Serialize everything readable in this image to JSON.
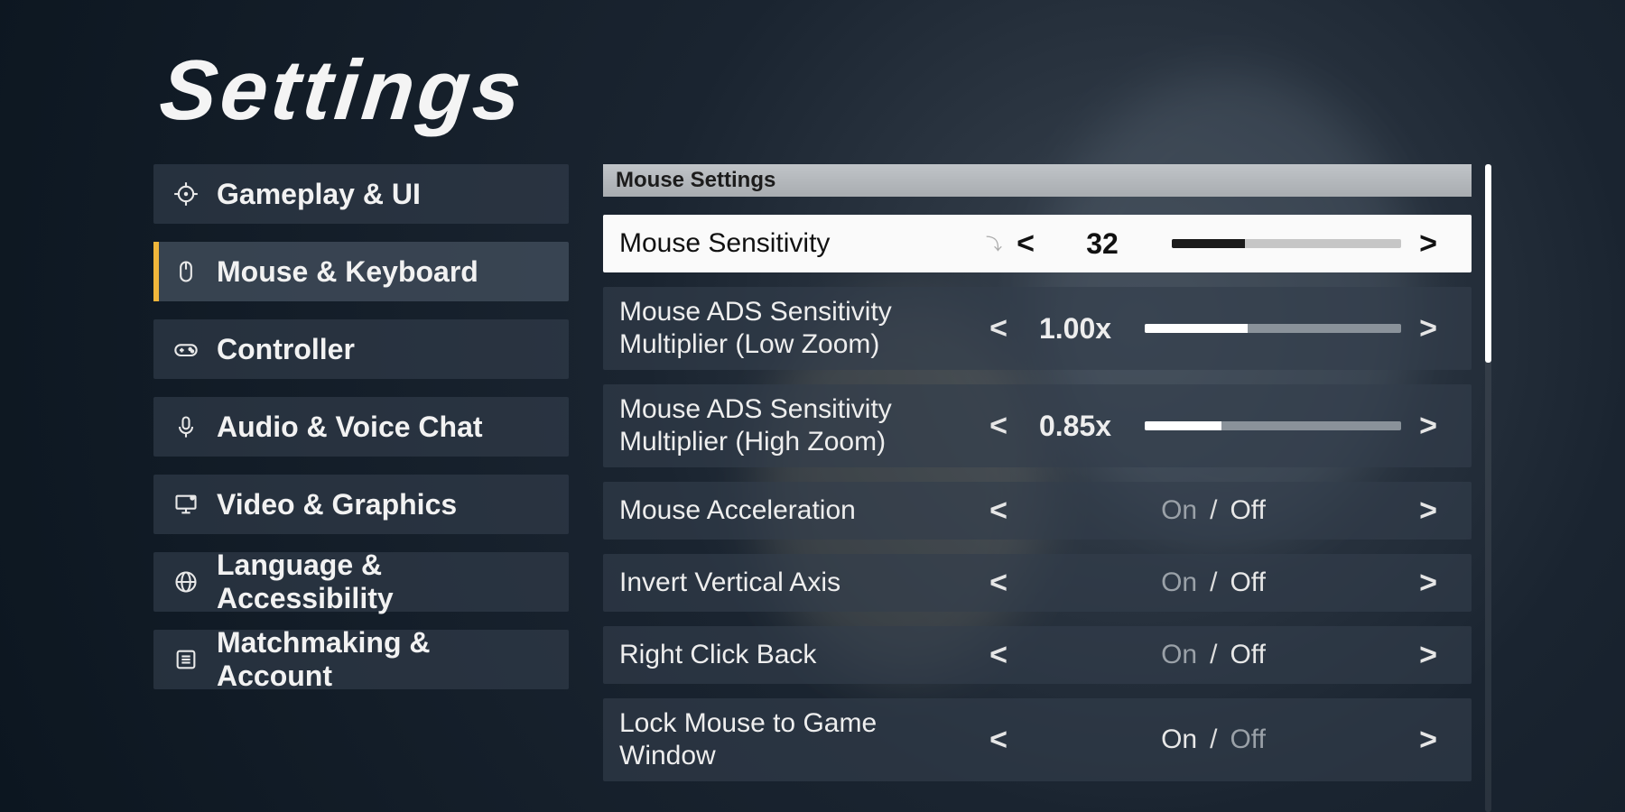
{
  "title": "Settings",
  "nav": {
    "items": [
      {
        "label": "Gameplay & UI",
        "icon": "crosshair-icon",
        "selected": false
      },
      {
        "label": "Mouse & Keyboard",
        "icon": "mouse-icon",
        "selected": true
      },
      {
        "label": "Controller",
        "icon": "gamepad-icon",
        "selected": false
      },
      {
        "label": "Audio & Voice Chat",
        "icon": "mic-icon",
        "selected": false
      },
      {
        "label": "Video & Graphics",
        "icon": "monitor-icon",
        "selected": false
      },
      {
        "label": "Language & Accessibility",
        "icon": "globe-icon",
        "selected": false
      },
      {
        "label": "Matchmaking & Account",
        "icon": "list-icon",
        "selected": false
      }
    ]
  },
  "panel": {
    "section_header": "Mouse Settings",
    "rows": [
      {
        "label": "Mouse Sensitivity",
        "kind": "slider",
        "value_text": "32",
        "fill_pct": 32,
        "highlight": true
      },
      {
        "label": "Mouse ADS Sensitivity Multiplier (Low Zoom)",
        "kind": "slider",
        "value_text": "1.00x",
        "fill_pct": 40,
        "highlight": false
      },
      {
        "label": "Mouse ADS Sensitivity Multiplier (High Zoom)",
        "kind": "slider",
        "value_text": "0.85x",
        "fill_pct": 30,
        "highlight": false
      },
      {
        "label": "Mouse Acceleration",
        "kind": "toggle",
        "on": "On",
        "off": "Off",
        "selected": "Off"
      },
      {
        "label": "Invert Vertical Axis",
        "kind": "toggle",
        "on": "On",
        "off": "Off",
        "selected": "Off"
      },
      {
        "label": "Right Click Back",
        "kind": "toggle",
        "on": "On",
        "off": "Off",
        "selected": "Off"
      },
      {
        "label": "Lock Mouse to Game Window",
        "kind": "toggle",
        "on": "On",
        "off": "Off",
        "selected": "On"
      }
    ]
  },
  "glyphs": {
    "left": "<",
    "right": ">",
    "sep": "/"
  }
}
